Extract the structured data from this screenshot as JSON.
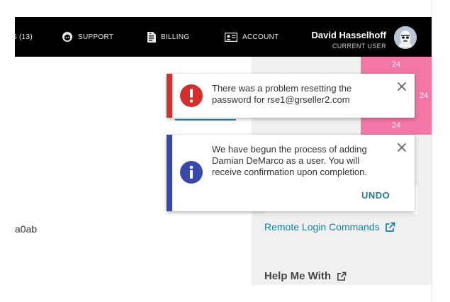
{
  "header": {
    "nav": [
      {
        "label": "S (13)"
      },
      {
        "label": "SUPPORT"
      },
      {
        "label": "BILLING"
      },
      {
        "label": "ACCOUNT"
      }
    ],
    "user_name": "David Hasselhoff",
    "user_role": "CURRENT USER"
  },
  "main": {
    "partial_text": "a0ab"
  },
  "sidebar": {
    "badges": [
      "24",
      "24",
      "24"
    ],
    "remote_link": "Remote Login Commands",
    "help_heading": "Help Me With"
  },
  "notifications": [
    {
      "type": "error",
      "color": "#d32f2f",
      "message": "There was a problem resetting the password for rse1@grseller2.com"
    },
    {
      "type": "info",
      "color": "#3949ab",
      "message": "We have begun the process of adding Damian DeMarco as a user. You will receive confirmation upon completion.",
      "action": "UNDO"
    }
  ]
}
